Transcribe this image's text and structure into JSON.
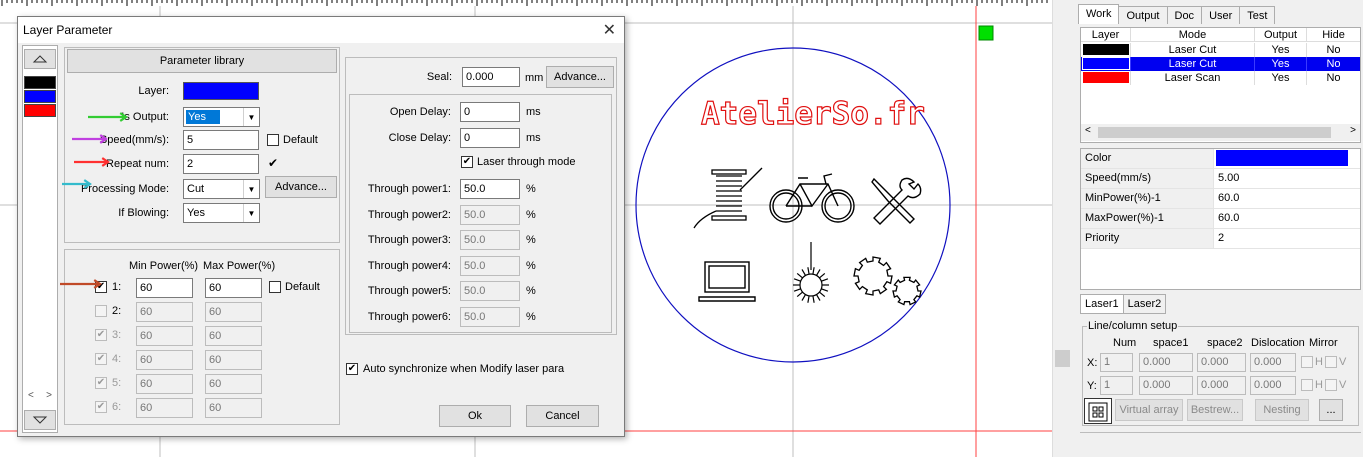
{
  "dialog": {
    "title": "Layer Parameter",
    "close_glyph": "✕",
    "parameter_library_label": "Parameter library",
    "layer_label": "Layer:",
    "layer_color": "#0000ff",
    "is_output_label": "Is Output:",
    "is_output_value": "Yes",
    "speed_label": "Speed(mm/s):",
    "speed_value": "5",
    "default_label": "Default",
    "repeat_label": "Repeat num:",
    "repeat_value": "2",
    "repeat_checked": "✔",
    "processing_mode_label": "Processing Mode:",
    "processing_mode_value": "Cut",
    "advance_label": "Advance...",
    "if_blowing_label": "If Blowing:",
    "if_blowing_value": "Yes",
    "min_power_header": "Min Power(%)",
    "max_power_header": "Max Power(%)",
    "power_default_label": "Default",
    "power_rows": [
      {
        "label": "1:",
        "min": "60",
        "max": "60",
        "checked": "✔"
      },
      {
        "label": "2:",
        "min": "60",
        "max": "60",
        "checked": ""
      },
      {
        "label": "3:",
        "min": "60",
        "max": "60",
        "checked": "✔"
      },
      {
        "label": "4:",
        "min": "60",
        "max": "60",
        "checked": "✔"
      },
      {
        "label": "5:",
        "min": "60",
        "max": "60",
        "checked": "✔"
      },
      {
        "label": "6:",
        "min": "60",
        "max": "60",
        "checked": "✔"
      }
    ],
    "seal_label": "Seal:",
    "seal_value": "0.000",
    "seal_unit": "mm",
    "seal_advance_label": "Advance...",
    "open_delay_label": "Open Delay:",
    "open_delay_value": "0",
    "close_delay_label": "Close Delay:",
    "close_delay_value": "0",
    "ms_unit": "ms",
    "laser_through_label": "Laser through mode",
    "laser_through_checked": "✔",
    "through_powers": [
      {
        "label": "Through power1:",
        "value": "50.0"
      },
      {
        "label": "Through power2:",
        "value": "50.0"
      },
      {
        "label": "Through power3:",
        "value": "50.0"
      },
      {
        "label": "Through power4:",
        "value": "50.0"
      },
      {
        "label": "Through power5:",
        "value": "50.0"
      },
      {
        "label": "Through power6:",
        "value": "50.0"
      }
    ],
    "pct_unit": "%",
    "auto_sync_label": "Auto synchronize when Modify laser para",
    "auto_sync_checked": "✔",
    "ok_label": "Ok",
    "cancel_label": "Cancel",
    "layer_swatches": [
      "#000000",
      "#0000ff",
      "#ff0000"
    ],
    "left_glyph": "<",
    "right_glyph": ">"
  },
  "canvas": {
    "logo_text": "AtelierSo.fr"
  },
  "panel": {
    "tabs": [
      "Work",
      "Output",
      "Doc",
      "User",
      "Test"
    ],
    "layer_table": {
      "headers": [
        "Layer",
        "Mode",
        "Output",
        "Hide"
      ],
      "rows": [
        {
          "color": "#000000",
          "mode": "Laser Cut",
          "output": "Yes",
          "hide": "No"
        },
        {
          "color": "#0000ff",
          "mode": "Laser Cut",
          "output": "Yes",
          "hide": "No"
        },
        {
          "color": "#ff0000",
          "mode": "Laser Scan",
          "output": "Yes",
          "hide": "No"
        }
      ]
    },
    "props": [
      {
        "key": "Color",
        "value": ""
      },
      {
        "key": "Speed(mm/s)",
        "value": "5.00"
      },
      {
        "key": "MinPower(%)-1",
        "value": "60.0"
      },
      {
        "key": "MaxPower(%)-1",
        "value": "60.0"
      },
      {
        "key": "Priority",
        "value": "2"
      }
    ],
    "prop_color": "#0000ff",
    "laser_tabs": [
      "Laser1",
      "Laser2"
    ],
    "line_column_title": "Line/column setup",
    "lc_headers": [
      "Num",
      "space1",
      "space2",
      "Dislocation",
      "Mirror"
    ],
    "x_label": "X:",
    "y_label": "Y:",
    "x_values": [
      "1",
      "0.000",
      "0.000",
      "0.000"
    ],
    "y_values": [
      "1",
      "0.000",
      "0.000",
      "0.000"
    ],
    "mirror_h": "H",
    "mirror_v": "V",
    "virtual_array_label": "Virtual array",
    "bestrew_label": "Bestrew...",
    "nesting_label": "Nesting",
    "more_label": "..."
  },
  "colors": {
    "selection": "#0000f0",
    "arrow_green": "#33cc33",
    "arrow_purple": "#c040e0",
    "arrow_red": "#ff3030",
    "arrow_cyan": "#33bbcc",
    "arrow_brown": "#c04a28"
  }
}
